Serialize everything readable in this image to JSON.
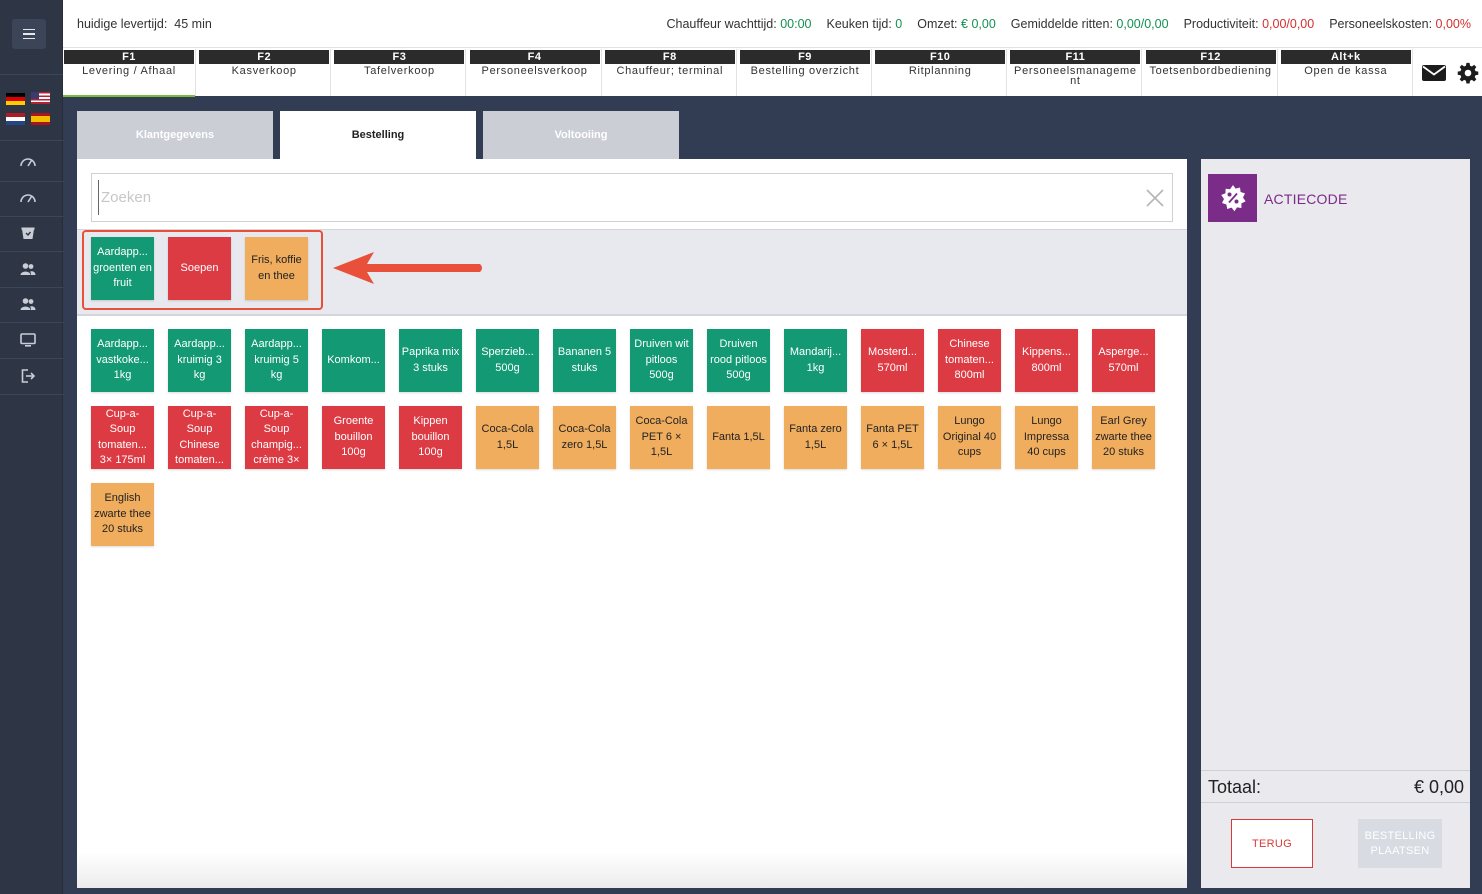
{
  "topbar": {
    "delivery_label": "huidige levertijd:",
    "delivery_value": "45 min",
    "stats": [
      {
        "label": "Chauffeur wachttijd:",
        "value": "00:00",
        "color": "#13914f"
      },
      {
        "label": "Keuken tijd:",
        "value": "0",
        "color": "#13914f"
      },
      {
        "label": "Omzet:",
        "value": "€ 0,00",
        "color": "#13914f"
      },
      {
        "label": "Gemiddelde ritten:",
        "value": "0,00/0,00",
        "color": "#13914f"
      },
      {
        "label": "Productiviteit:",
        "value": "0,00/0,00",
        "color": "#d42f2f"
      },
      {
        "label": "Personeelskosten:",
        "value": "0,00%",
        "color": "#d42f2f"
      }
    ]
  },
  "fkeys": [
    {
      "key": "F1",
      "label": "Levering / Afhaal",
      "active": true
    },
    {
      "key": "F2",
      "label": "Kasverkoop"
    },
    {
      "key": "F3",
      "label": "Tafelverkoop"
    },
    {
      "key": "F4",
      "label": "Personeelsverkoop"
    },
    {
      "key": "F8",
      "label": "Chauffeur; terminal"
    },
    {
      "key": "F9",
      "label": "Bestelling overzicht"
    },
    {
      "key": "F10",
      "label": "Ritplanning"
    },
    {
      "key": "F11",
      "label": "Personeelsmanageme nt"
    },
    {
      "key": "F12",
      "label": "Toetsenbordbediening"
    },
    {
      "key": "Alt+k",
      "label": "Open de kassa"
    }
  ],
  "toolbar_icons": {
    "mail": "envelope-icon",
    "settings": "gear-icon"
  },
  "sidebar": {
    "flags": [
      "flag-germany",
      "flag-usa",
      "flag-netherlands",
      "flag-spain"
    ],
    "icons": [
      "dashboard-gauge-icon",
      "dashboard-gauge-icon",
      "basket-icon",
      "users-icon",
      "users-icon",
      "monitor-icon",
      "logout-icon"
    ]
  },
  "tabs": [
    {
      "label": "Klantgegevens",
      "active": false
    },
    {
      "label": "Bestelling",
      "active": true
    },
    {
      "label": "Voltooiing",
      "active": false
    }
  ],
  "search": {
    "placeholder": "Zoeken",
    "value": ""
  },
  "categories": [
    {
      "label": "Aardapp... groenten en fruit",
      "color": "green"
    },
    {
      "label": "Soepen",
      "color": "red"
    },
    {
      "label": "Fris, koffie en thee",
      "color": "orange"
    }
  ],
  "products": [
    {
      "label": "Aardapp... vastkoke... 1kg",
      "color": "green"
    },
    {
      "label": "Aardapp... kruimig 3 kg",
      "color": "green"
    },
    {
      "label": "Aardapp... kruimig 5 kg",
      "color": "green"
    },
    {
      "label": "Komkom...",
      "color": "green"
    },
    {
      "label": "Paprika mix 3 stuks",
      "color": "green"
    },
    {
      "label": "Sperzieb... 500g",
      "color": "green"
    },
    {
      "label": "Bananen 5 stuks",
      "color": "green"
    },
    {
      "label": "Druiven wit pitloos 500g",
      "color": "green"
    },
    {
      "label": "Druiven rood pitloos 500g",
      "color": "green"
    },
    {
      "label": "Mandarij... 1kg",
      "color": "green"
    },
    {
      "label": "Mosterd... 570ml",
      "color": "red"
    },
    {
      "label": "Chinese tomaten... 800ml",
      "color": "red"
    },
    {
      "label": "Kippens... 800ml",
      "color": "red"
    },
    {
      "label": "Asperge... 570ml",
      "color": "red"
    },
    {
      "label": "Cup-a-Soup tomaten... 3× 175ml",
      "color": "red"
    },
    {
      "label": "Cup-a-Soup Chinese tomaten...",
      "color": "red"
    },
    {
      "label": "Cup-a-Soup champig... crème 3×",
      "color": "red"
    },
    {
      "label": "Groente bouillon 100g",
      "color": "red"
    },
    {
      "label": "Kippen bouillon 100g",
      "color": "red"
    },
    {
      "label": "Coca-Cola 1,5L",
      "color": "orange"
    },
    {
      "label": "Coca-Cola zero 1,5L",
      "color": "orange"
    },
    {
      "label": "Coca-Cola PET 6 × 1,5L",
      "color": "orange"
    },
    {
      "label": "Fanta 1,5L",
      "color": "orange"
    },
    {
      "label": "Fanta zero 1,5L",
      "color": "orange"
    },
    {
      "label": "Fanta PET 6 × 1,5L",
      "color": "orange"
    },
    {
      "label": "Lungo Original 40 cups",
      "color": "orange"
    },
    {
      "label": "Lungo Impressa 40 cups",
      "color": "orange"
    },
    {
      "label": "Earl Grey zwarte thee 20 stuks",
      "color": "orange"
    },
    {
      "label": "English zwarte thee 20 stuks",
      "color": "orange"
    }
  ],
  "cart": {
    "action_code_label": "ACTIECODE",
    "action_code_icon": "percent-badge-icon",
    "total_label": "Totaal:",
    "total_value": "€ 0,00",
    "back_label": "TERUG",
    "place_order_label": "BESTELLING PLAATSEN"
  },
  "colors": {
    "green": "#139a74",
    "red": "#dd3b44",
    "orange": "#f0ad5e",
    "accent_purple": "#7b2b88",
    "annotation_red": "#e8503a"
  }
}
